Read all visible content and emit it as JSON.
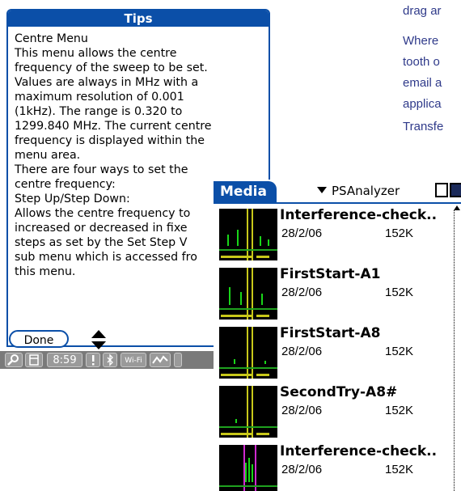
{
  "background_document": {
    "lines": [
      "drag ar",
      "Where",
      "tooth o",
      "email a",
      "applica",
      "Transfe"
    ]
  },
  "tips": {
    "title": "Tips",
    "lines": [
      "Centre Menu",
      "This menu allows the centre",
      "frequency of the sweep to be set.",
      "Values are always in MHz with a",
      "maximum resolution of 0.001",
      "(1kHz). The range is 0.320 to",
      "1299.840 MHz. The current centre",
      "frequency is displayed within the",
      "menu area.",
      "There are four ways to set the",
      "centre frequency:",
      "Step Up/Step Down:",
      "Allows the centre frequency to",
      "increased or decreased in fixe",
      "steps as set by the Set Step V",
      "sub menu which is accessed fro",
      "this menu."
    ],
    "done_label": "Done"
  },
  "statusbar": {
    "time": "8:59",
    "wifi_label": "Wi-Fi"
  },
  "media": {
    "tab_label": "Media",
    "app_selector": "PSAnalyzer",
    "items": [
      {
        "name": "Interference-check..",
        "date": "28/2/06",
        "size": "152K"
      },
      {
        "name": "FirstStart-A1",
        "date": "28/2/06",
        "size": "152K"
      },
      {
        "name": "FirstStart-A8",
        "date": "28/2/06",
        "size": "152K"
      },
      {
        "name": "SecondTry-A8#",
        "date": "28/2/06",
        "size": "152K"
      },
      {
        "name": "Interference-check..",
        "date": "28/2/06",
        "size": "152K"
      }
    ]
  },
  "colors": {
    "accent": "#0b4fa8",
    "status_bar": "#7a7a7a",
    "trace": "#19d619",
    "marker": "#c8c81a"
  }
}
